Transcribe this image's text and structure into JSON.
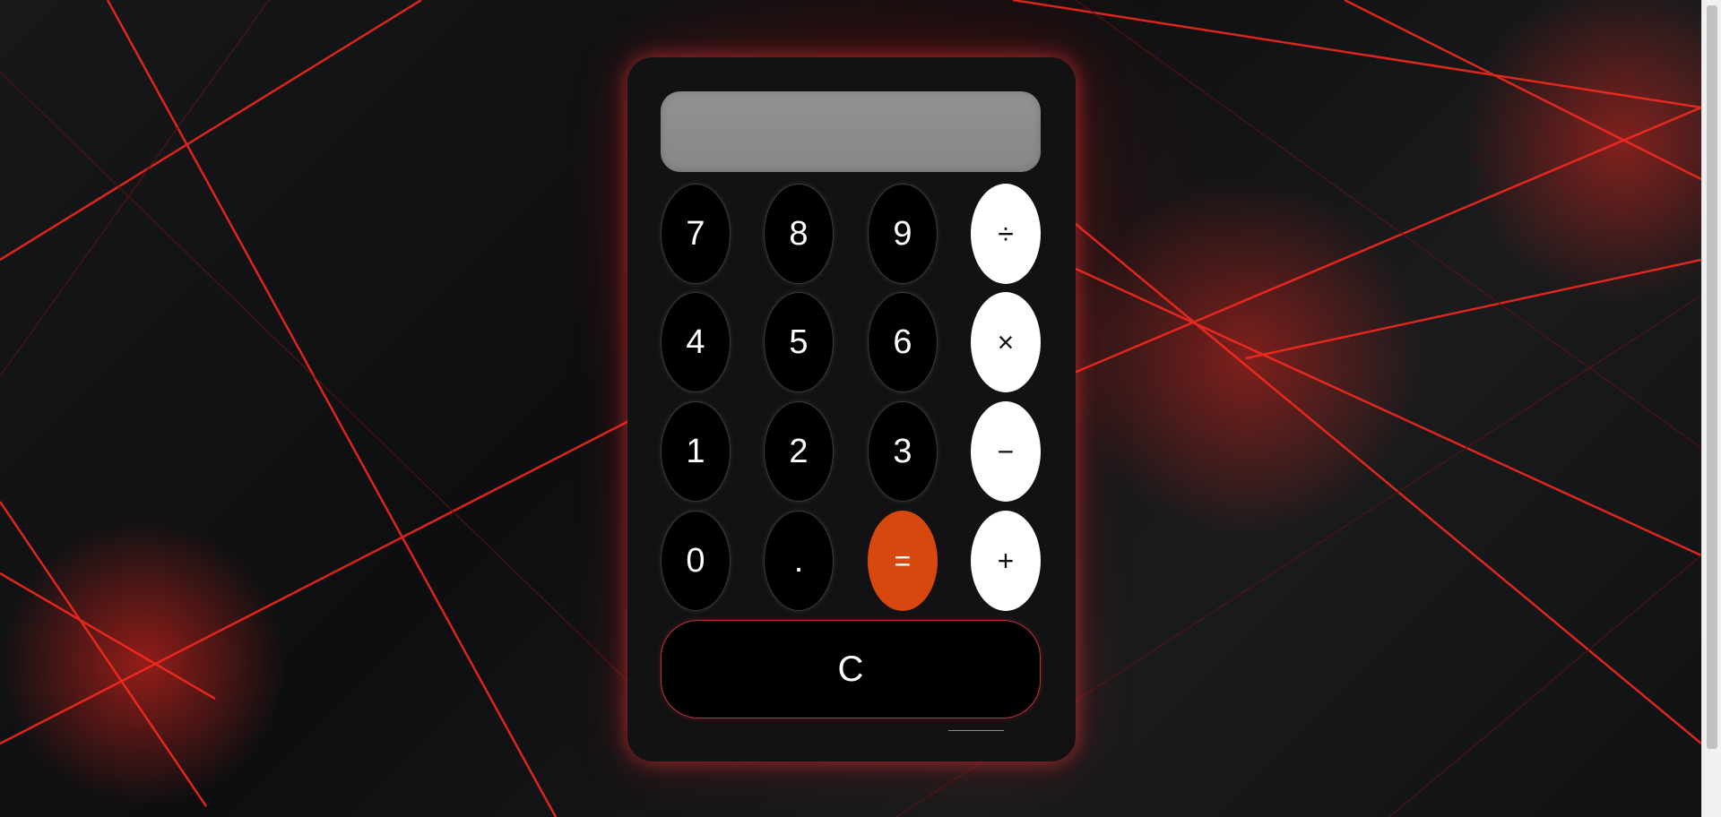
{
  "display": {
    "value": ""
  },
  "keys": {
    "seven": "7",
    "eight": "8",
    "nine": "9",
    "divide": "÷",
    "four": "4",
    "five": "5",
    "six": "6",
    "multiply": "×",
    "one": "1",
    "two": "2",
    "three": "3",
    "subtract": "−",
    "zero": "0",
    "decimal": ".",
    "equals": "=",
    "add": "+",
    "clear": "C"
  },
  "colors": {
    "accent_equals": "#d8470d",
    "operator_key": "#ffffff",
    "number_key": "#000000",
    "display_bg": "#8c8c8c",
    "glow": "#ff3c3c"
  }
}
